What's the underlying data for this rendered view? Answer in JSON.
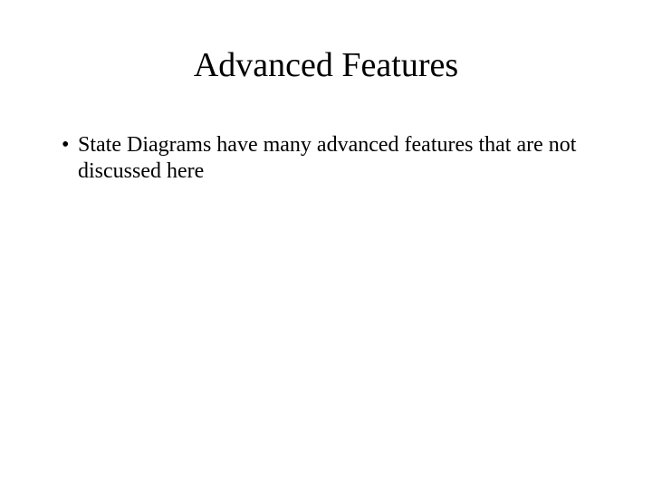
{
  "slide": {
    "title": "Advanced Features",
    "bullets": [
      "State Diagrams have many advanced features that are not discussed here"
    ]
  }
}
